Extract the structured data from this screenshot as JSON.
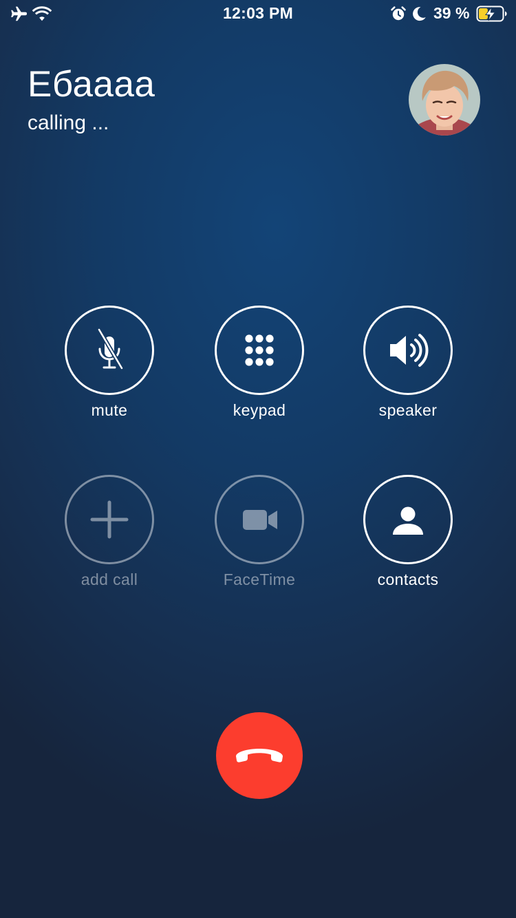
{
  "status_bar": {
    "time": "12:03 PM",
    "battery_text": "39 %",
    "battery_level": 0.39,
    "icons": [
      "airplane-icon",
      "wifi-icon",
      "alarm-icon",
      "moon-icon",
      "battery-charging-icon"
    ]
  },
  "call": {
    "caller_name": "Ебаааа",
    "status": "calling ..."
  },
  "controls": [
    {
      "id": "mute",
      "label": "mute",
      "icon": "mic-muted-icon",
      "enabled": true
    },
    {
      "id": "keypad",
      "label": "keypad",
      "icon": "keypad-icon",
      "enabled": true
    },
    {
      "id": "speaker",
      "label": "speaker",
      "icon": "speaker-icon",
      "enabled": true
    },
    {
      "id": "add_call",
      "label": "add call",
      "icon": "plus-icon",
      "enabled": false
    },
    {
      "id": "facetime",
      "label": "FaceTime",
      "icon": "video-camera-icon",
      "enabled": false
    },
    {
      "id": "contacts",
      "label": "contacts",
      "icon": "person-icon",
      "enabled": true
    }
  ],
  "end_call": {
    "icon": "hang-up-icon",
    "color": "#fc3d2e"
  },
  "colors": {
    "background_top": "#134477",
    "background_bottom": "#16253d",
    "end_call": "#fc3d2e",
    "battery_charging": "#f8cf2a"
  }
}
